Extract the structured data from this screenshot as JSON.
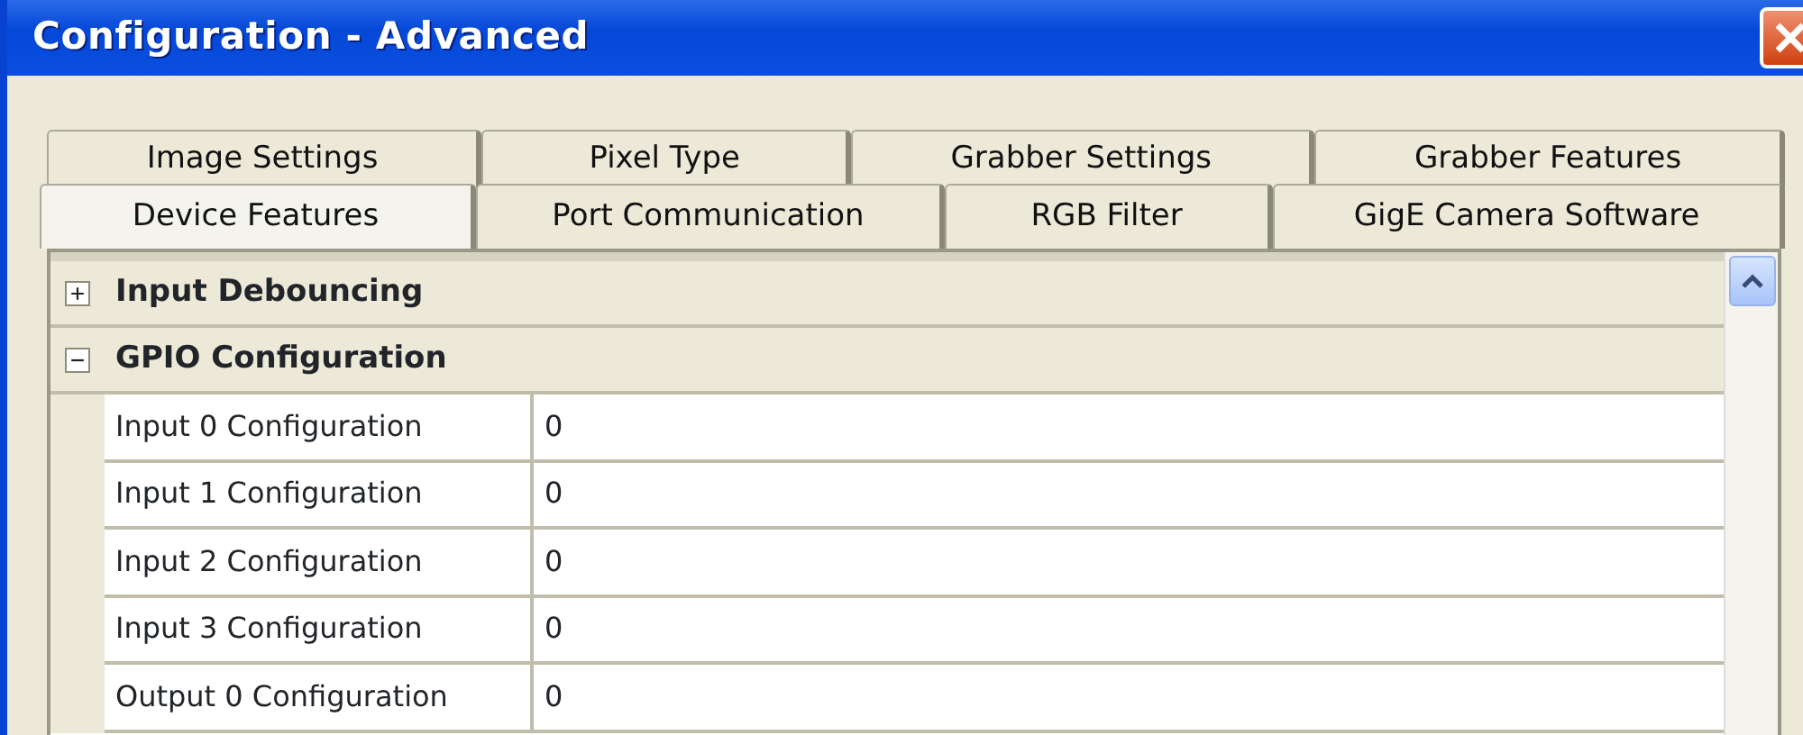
{
  "window": {
    "title": "Configuration - Advanced"
  },
  "tab_rows": [
    [
      {
        "label": "Image Settings",
        "selected": false
      },
      {
        "label": "Pixel Type",
        "selected": false
      },
      {
        "label": "Grabber Settings",
        "selected": false
      },
      {
        "label": "Grabber Features",
        "selected": false
      }
    ],
    [
      {
        "label": "Device Features",
        "selected": true
      },
      {
        "label": "Port Communication",
        "selected": false
      },
      {
        "label": "RGB Filter",
        "selected": false
      },
      {
        "label": "GigE Camera Software",
        "selected": false
      }
    ]
  ],
  "property_grid": {
    "categories": [
      {
        "label": "Input Debouncing",
        "expanded": false
      },
      {
        "label": "GPIO Configuration",
        "expanded": true,
        "children": [
          {
            "name": "Input 0 Configuration",
            "value": "0"
          },
          {
            "name": "Input 1 Configuration",
            "value": "0"
          },
          {
            "name": "Input 2 Configuration",
            "value": "0"
          },
          {
            "name": "Input 3 Configuration",
            "value": "0"
          },
          {
            "name": "Output 0 Configuration",
            "value": "0"
          }
        ]
      }
    ]
  }
}
